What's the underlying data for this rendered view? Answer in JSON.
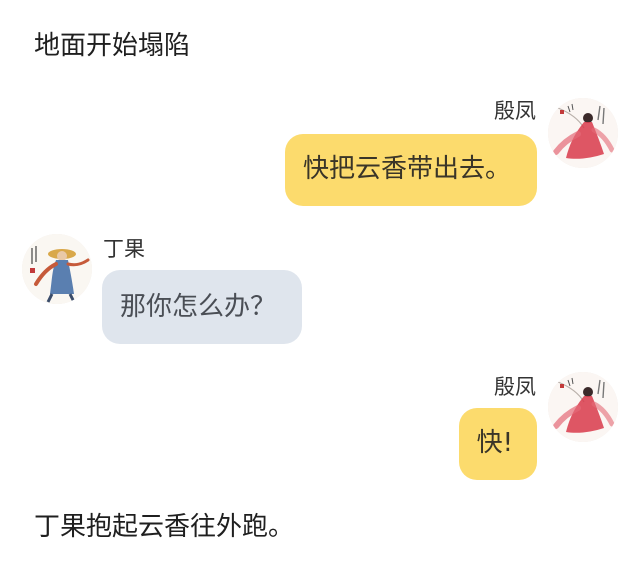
{
  "narration": {
    "top": "地面开始塌陷",
    "bottom": "丁果抱起云香往外跑。"
  },
  "messages": [
    {
      "speaker": "殷凤",
      "side": "right",
      "text": "快把云香带出去。",
      "bubble_color": "#fcdb6d",
      "avatar_icon": "ink-painting-red-robed-figure-avatar"
    },
    {
      "speaker": "丁果",
      "side": "left",
      "text": "那你怎么办？",
      "bubble_color": "#dfe5ed",
      "avatar_icon": "ink-painting-straw-hat-figure-avatar"
    },
    {
      "speaker": "殷凤",
      "side": "right",
      "text": "快!",
      "bubble_color": "#fcdb6d",
      "avatar_icon": "ink-painting-red-robed-figure-avatar"
    }
  ]
}
